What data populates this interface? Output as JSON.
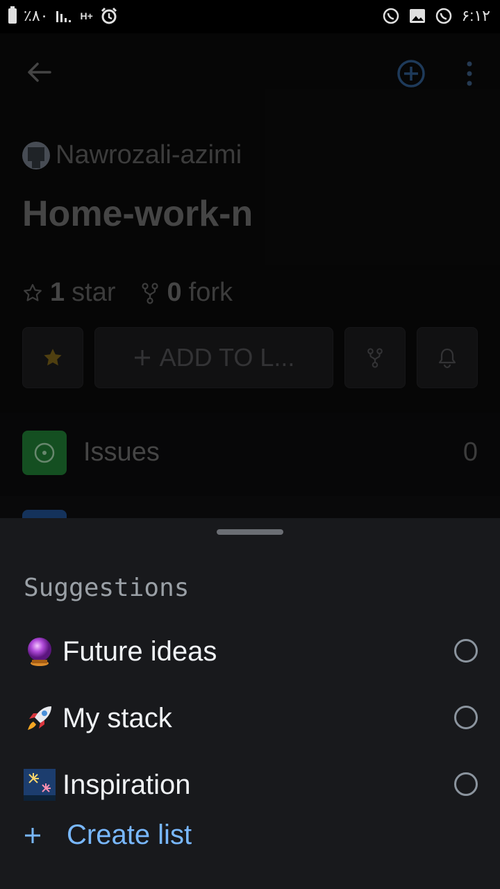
{
  "status_bar": {
    "battery": "٪۸۰",
    "network": "H+",
    "time": "۶:۱۲"
  },
  "repo": {
    "owner": "Nawrozali-azimi",
    "name": "Home-work-n",
    "stars_count": "1",
    "stars_label": "star",
    "forks_count": "0",
    "forks_label": "fork",
    "add_to_list_label": "ADD TO L..."
  },
  "issues": {
    "label": "Issues",
    "count": "0"
  },
  "sheet": {
    "title": "Suggestions",
    "items": [
      {
        "emoji": "crystal-ball",
        "label": "Future ideas"
      },
      {
        "emoji": "rocket",
        "label": "My stack"
      },
      {
        "emoji": "fireworks",
        "label": "Inspiration"
      }
    ],
    "create_label": "Create list"
  },
  "colors": {
    "accent": "#79b8ff",
    "issues_green": "#1f7a33",
    "star_yellow": "#c9a227"
  }
}
